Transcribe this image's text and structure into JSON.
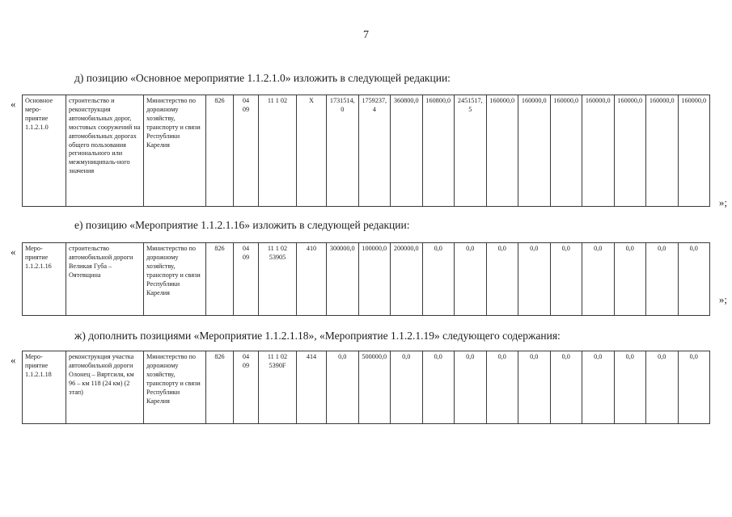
{
  "document": {
    "page_number": "7",
    "quote_open": "«",
    "quote_close": "»;"
  },
  "paragraphs": {
    "d": "д) позицию «Основное мероприятие 1.1.2.1.0» изложить в следующей редакции:",
    "e": "е) позицию «Мероприятие 1.1.2.1.16» изложить в следующей редакции:",
    "zh": "ж) дополнить позициями «Мероприятие 1.1.2.1.18», «Мероприятие 1.1.2.1.19» следующего содержания:"
  },
  "tables": [
    {
      "id": "table-osnovnoe-1-1-2-1-0",
      "name": "Основное\nмеро-\nприятие\n1.1.2.1.0",
      "description": "строительство и реконструкция автомобильных дорог, мостовых сооружений на автомобильных дорогах общего пользования регионального или межмуниципаль-ного значения",
      "executor": "Министерство по дорожному хозяйству, транспорту и связи Республики Карелия",
      "gl": "826",
      "rz_pr": "04\n09",
      "csr": "11 1 02",
      "vr": "X",
      "values": [
        "1731514,0",
        "1759237,4",
        "360800,0",
        "160800,0",
        "2451517,5",
        "160000,0",
        "160000,0",
        "160000,0",
        "160000,0",
        "160000,0",
        "160000,0",
        "160000,0"
      ]
    },
    {
      "id": "table-meropriyatie-1-1-2-1-16",
      "name": "Меро-\nприятие\n1.1.2.1.16",
      "description": "строительство автомобильной дороги Великая Губа – Оятевщина",
      "executor": "Министерство по дорожному хозяйству, транспорту и связи Республики Карелия",
      "gl": "826",
      "rz_pr": "04\n09",
      "csr": "11 1 02\n53905",
      "vr": "410",
      "values": [
        "300000,0",
        "100000,0",
        "200000,0",
        "0,0",
        "0,0",
        "0,0",
        "0,0",
        "0,0",
        "0,0",
        "0,0",
        "0,0",
        "0,0"
      ]
    },
    {
      "id": "table-meropriyatie-1-1-2-1-18",
      "name": "Меро-\nприятие\n1.1.2.1.18",
      "description": "реконструкция участка автомобильной дороги Олонец – Вяртсиля, км 96 – км 118 (24 км) (2 этап)",
      "executor": "Министерство по дорожному хозяйству, транспорту и связи Республики Карелия",
      "gl": "826",
      "rz_pr": "04\n09",
      "csr": "11 1 02\n5390F",
      "vr": "414",
      "values": [
        "0,0",
        "500000,0",
        "0,0",
        "0,0",
        "0,0",
        "0,0",
        "0,0",
        "0,0",
        "0,0",
        "0,0",
        "0,0",
        "0,0"
      ]
    }
  ]
}
